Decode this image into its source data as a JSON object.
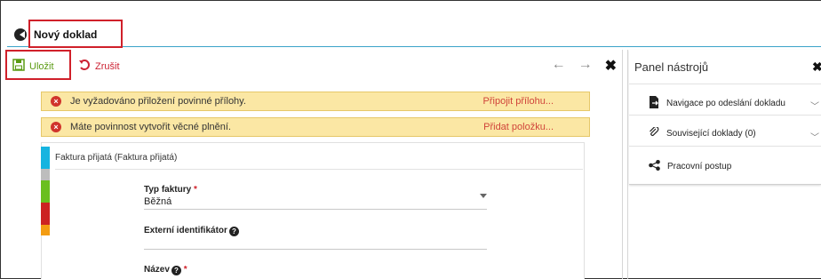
{
  "header": {
    "title": "Nový doklad"
  },
  "toolbar": {
    "save_label": "Uložit",
    "cancel_label": "Zrušit",
    "icons": [
      "arrow-left-icon",
      "arrow-right-icon",
      "close-icon"
    ]
  },
  "alerts": [
    {
      "message": "Je vyžadováno přiložení povinné přílohy.",
      "action": "Připojit přílohu..."
    },
    {
      "message": "Máte povinnost vytvořit věcné plnění.",
      "action": "Přidat položku..."
    }
  ],
  "form": {
    "header": "Faktura přijatá (Faktura přijatá)",
    "colors": [
      "#16b4e0",
      "#16b4e0",
      "#bdbdbd",
      "#6abf1e",
      "#6abf1e",
      "#cc2222",
      "#cc2222",
      "#f39c12"
    ],
    "fields": [
      {
        "label": "Typ faktury",
        "required": "*",
        "value": "Běžná"
      },
      {
        "label": "Externí identifikátor",
        "help": "?",
        "value": ""
      },
      {
        "label": "Název",
        "help": "?",
        "required": "*",
        "value": ""
      }
    ]
  },
  "panel": {
    "title": "Panel nástrojů",
    "items": [
      {
        "label": "Navigace po odeslání dokladu",
        "icon": "document-export-icon"
      },
      {
        "label": "Související doklady (0)",
        "icon": "paperclip-icon"
      },
      {
        "label": "Pracovní postup",
        "icon": "share-icon"
      }
    ]
  }
}
